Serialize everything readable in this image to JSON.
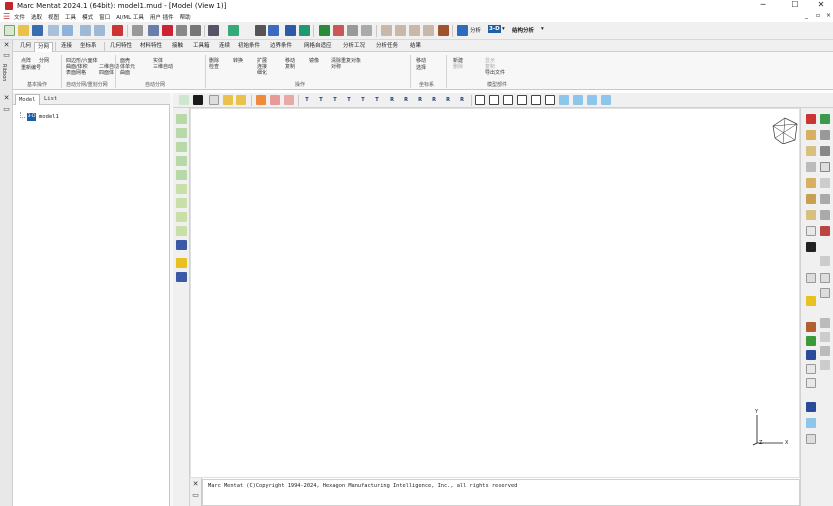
{
  "window": {
    "title": "Marc Mentat 2024.1 (64bit): model1.mud - [Model (View 1)]",
    "minimize": "─",
    "maximize": "☐",
    "close": "✕"
  },
  "menubar": {
    "items": [
      "文件",
      "选取",
      "视图",
      "工具",
      "模式",
      "窗口",
      "AI/ML 工具",
      "用户 插件",
      "帮助"
    ],
    "right_controls": [
      "_",
      "▫",
      "×"
    ]
  },
  "toolbar": {
    "analysis_label": "分析",
    "mode_label": "3-D",
    "result_label": "结构分析"
  },
  "left_strip": {
    "close_glyph": "✕",
    "pin_glyph": "▭",
    "vertical_label": "Ribbon"
  },
  "ribbon_tabs": [
    "几何",
    "分网",
    "连接",
    "坐标系",
    "几何特性",
    "材料特性",
    "接触",
    "工具箱",
    "连续",
    "初始条件",
    "边界条件",
    "网格自适应",
    "分析工况",
    "分析任务",
    "结果"
  ],
  "ribbon": {
    "groups": [
      {
        "name": "基本操作",
        "items": [
          "点阵",
          "分网",
          "重新编号"
        ]
      },
      {
        "name": "自动分网/重划分网",
        "items": [
          "四边形/六面体",
          "曲面/体积",
          "表面网格",
          "二维自动",
          "四面体",
          "网格修复"
        ]
      },
      {
        "name": "自动分网",
        "items": [
          "面壳",
          "体单元",
          "曲面",
          "实体",
          "三维自动",
          "镜像"
        ]
      },
      {
        "name": "操作",
        "items": [
          "删除",
          "检查",
          "扩展",
          "移动",
          "复制",
          "连接",
          "细化",
          "镜像",
          "转换",
          "清除重复对象",
          "对称"
        ]
      },
      {
        "name": "坐标系",
        "items": [
          "移动",
          "选择"
        ]
      },
      {
        "name": "模型部件",
        "items": [
          "新建",
          "显示",
          "删除",
          "复制",
          "导出文件"
        ]
      }
    ]
  },
  "tree_panel": {
    "tabs": [
      "Model",
      "List"
    ],
    "item_icon": "3-D",
    "item_label": "model1"
  },
  "view_toolbar": {
    "texts": [
      "T",
      "T",
      "T",
      "T",
      "T",
      "T",
      "R",
      "R",
      "R",
      "R",
      "R",
      "R"
    ]
  },
  "console": {
    "text": "Marc Mentat (C)Copyright 1994-2024, Hexagon Manufacturing Intelligence, Inc., all rights reserved"
  },
  "triad": {
    "x": "X",
    "y": "Y",
    "z": "Z"
  },
  "colors": {
    "accent_blue": "#1f5fa8",
    "app_red": "#c0282d"
  }
}
